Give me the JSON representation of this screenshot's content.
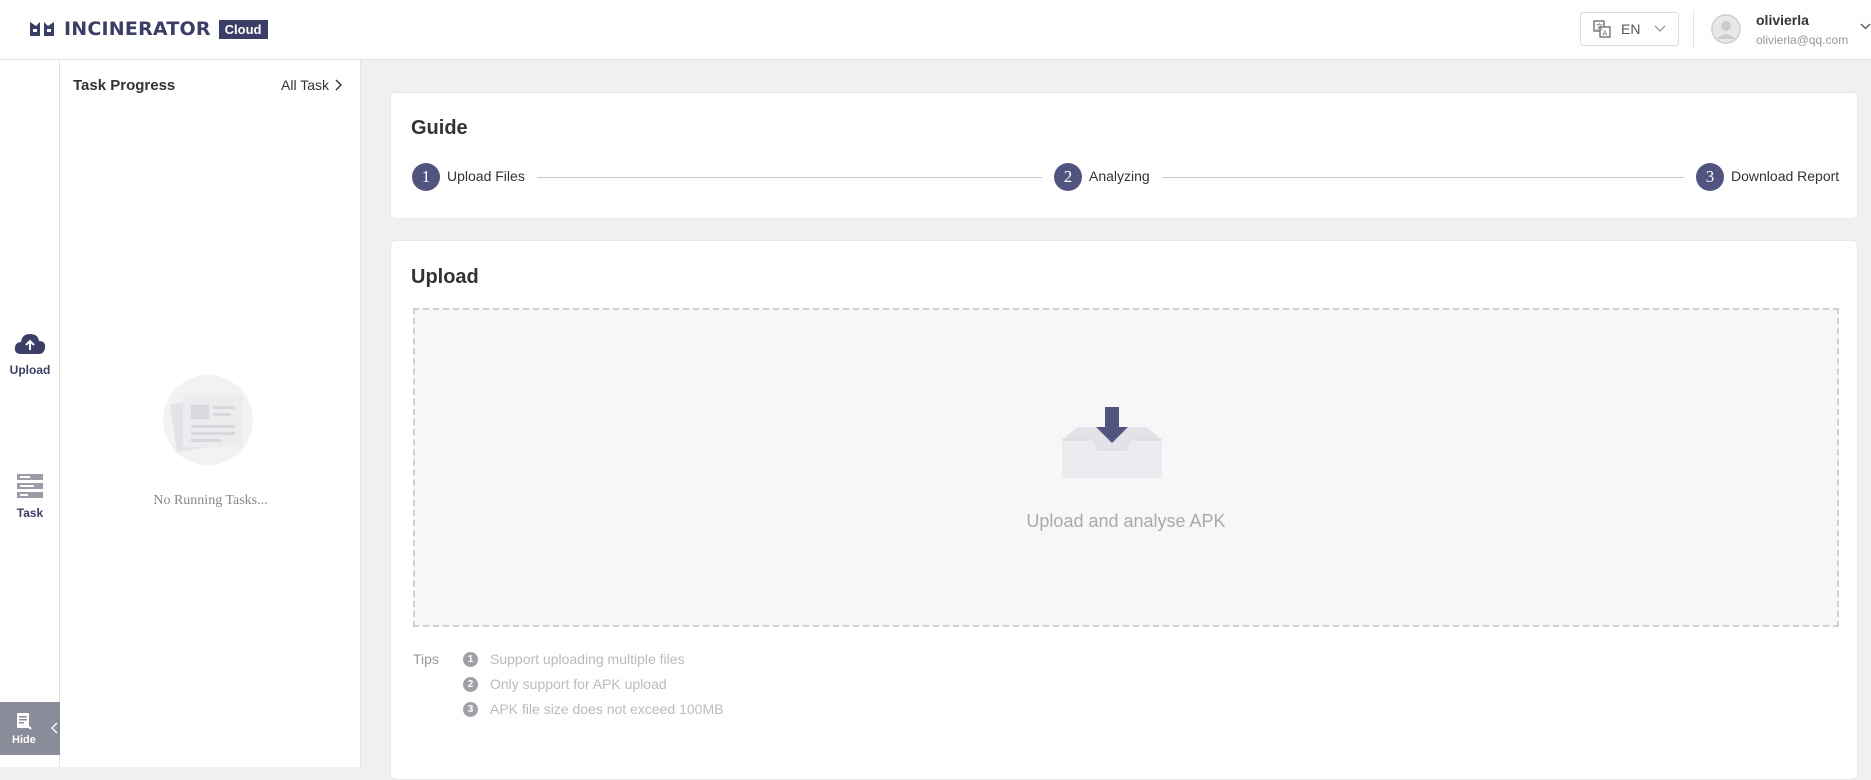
{
  "header": {
    "logo_text": "INCINERATOR",
    "logo_badge": "Cloud",
    "language": "EN",
    "user_name": "olivierla",
    "user_email": "olivierla@qq.com"
  },
  "leftnav": {
    "upload_label": "Upload",
    "task_label": "Task",
    "hide_label": "Hide"
  },
  "task_panel": {
    "title": "Task Progress",
    "all_task": "All Task",
    "empty_text": "No Running Tasks..."
  },
  "guide": {
    "title": "Guide",
    "steps": [
      {
        "num": "1",
        "label": "Upload Files"
      },
      {
        "num": "2",
        "label": "Analyzing"
      },
      {
        "num": "3",
        "label": "Download Report"
      }
    ]
  },
  "upload": {
    "title": "Upload",
    "drop_text": "Upload and analyse APK",
    "tips_label": "Tips",
    "tips": [
      {
        "num": "1",
        "text": "Support uploading multiple files"
      },
      {
        "num": "2",
        "text": "Only support for APK upload"
      },
      {
        "num": "3",
        "text": "APK file size does not exceed 100MB"
      }
    ]
  },
  "colors": {
    "brand": "#3b3e66",
    "step_circle": "#525480"
  }
}
